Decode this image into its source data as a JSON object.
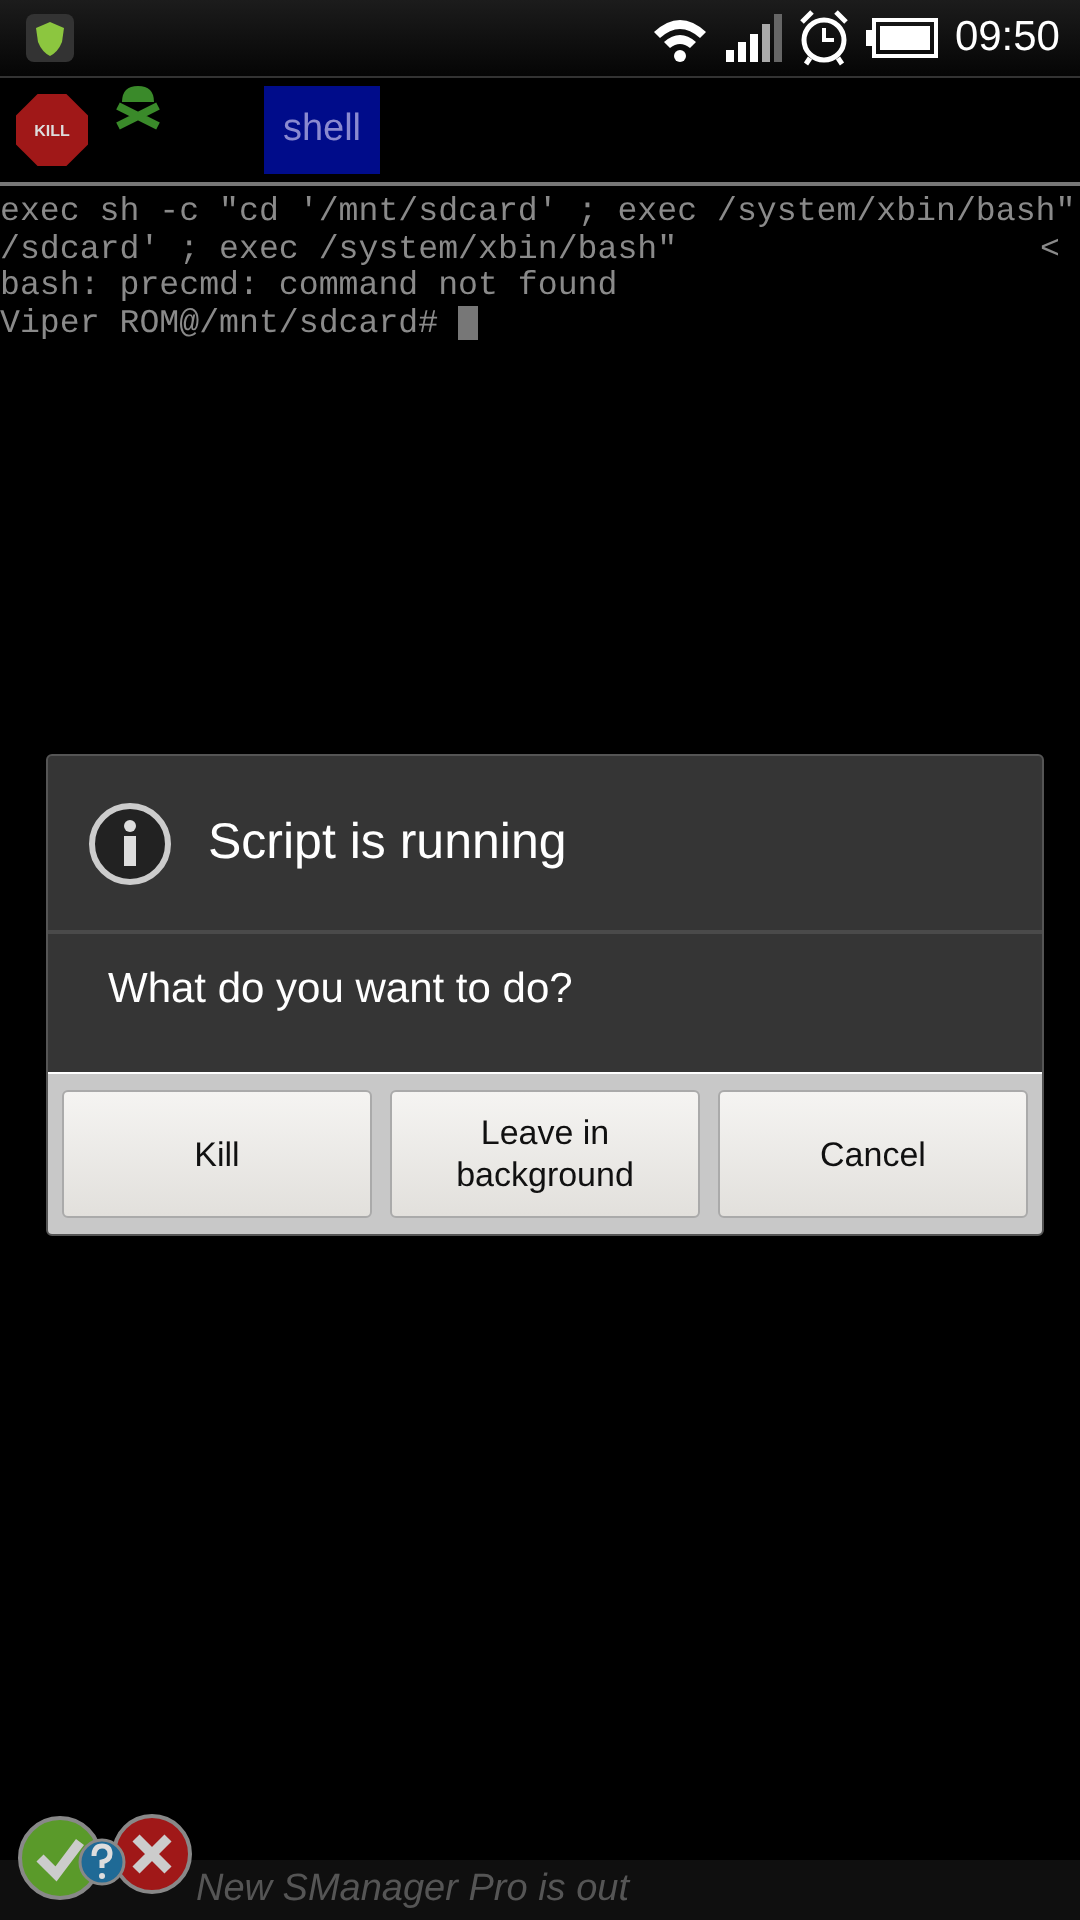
{
  "status_bar": {
    "time": "09:50"
  },
  "toolbar": {
    "kill_label": "KILL",
    "tab": "shell"
  },
  "terminal": {
    "lines": [
      {
        "text": "exec sh -c \"cd '/mnt/sdcard' ; exec /system/xbin/bash\""
      },
      {
        "text": "/sdcard' ; exec /system/xbin/bash\"",
        "marker": "<"
      },
      {
        "text": "bash: precmd: command not found"
      },
      {
        "text": "Viper ROM@/mnt/sdcard# ",
        "cursor": true
      }
    ]
  },
  "dialog": {
    "title": "Script is running",
    "message": "What do you want to do?",
    "buttons": [
      "Kill",
      "Leave in\nbackground",
      "Cancel"
    ]
  },
  "notification": {
    "text": "New SManager Pro is out"
  }
}
